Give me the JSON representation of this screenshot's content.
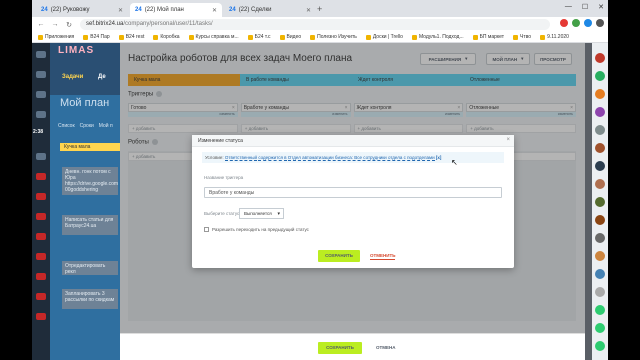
{
  "browser": {
    "tabs": [
      {
        "icon": "24",
        "label": "(22) Руковожу"
      },
      {
        "icon": "24",
        "label": "(22) Мой план"
      },
      {
        "icon": "24",
        "label": "(22) Сделки"
      }
    ],
    "new_tab": "+",
    "url_host": "sef.bitrix24.ua",
    "url_path": "/company/personal/user/11/tasks/",
    "bookmarks": [
      "Приложения",
      "B24 Пар",
      "B24 rest",
      "Коробка",
      "Курсы справка м...",
      "Б24 т.с",
      "Видео",
      "Полезно Изучить",
      "Доски | Trello",
      "Модуль1. Подход...",
      "БП маркет",
      "Чтво",
      "9.11.2020"
    ]
  },
  "app": {
    "logo": "LIMAS",
    "tab_tasks": "Задачи",
    "tab_other": "Де",
    "my_plan": "Мой план",
    "filters": [
      "Список",
      "Сроки",
      "Мой п"
    ],
    "clock": "2:38",
    "kanban_col": "Кучка мала",
    "cards": [
      "Дневн. гонк потом с Юра https://drive.google.com 00goddshering",
      "Написать статьи для Батраус24.ua",
      "Отредактировать рекл",
      "Запланировать 3 рассылки по скидкам"
    ]
  },
  "robots_page": {
    "title": "Настройка роботов для всех задач Моего плана",
    "btn_extensions": "РАСШИРЕНИЯ",
    "btn_myplan": "МОЙ ПЛАН",
    "btn_view": "ПРОСМОТР",
    "stages": [
      {
        "name": "Кучка мала",
        "color": "#f6a623"
      },
      {
        "name": "В работе команды",
        "color": "#5fd4f1"
      },
      {
        "name": "Ждет контроля",
        "color": "#5fd4f1"
      },
      {
        "name": "Отложенные",
        "color": "#5fd4f1"
      }
    ],
    "triggers_label": "Триггеры",
    "robots_label": "Роботы",
    "triggers": [
      "Готово",
      "Вработе у команды",
      "Ждет контроля",
      "Отложенные"
    ],
    "trigger_edit": "изменить",
    "add_label": "+ добавить",
    "save": "СОХРАНИТЬ",
    "cancel": "ОТМЕНА"
  },
  "popup": {
    "title": "Изменение статуса",
    "condition_prefix": "Условие:",
    "condition_field": "Ответственный",
    "condition_op": "содержится в",
    "condition_value": "Отдел автоматизации бизнеса: Все сотрудники отдела с подотделами",
    "condition_remove": "[x]",
    "trigger_name_label": "Название триггера",
    "trigger_name_value": "Вработе у команды",
    "status_label": "Выберите статус",
    "status_value": "Выполняется",
    "allow_back": "Разрешить переходить на предыдущий статус",
    "save": "СОХРАНИТЬ",
    "cancel": "ОТМЕНИТЬ"
  }
}
